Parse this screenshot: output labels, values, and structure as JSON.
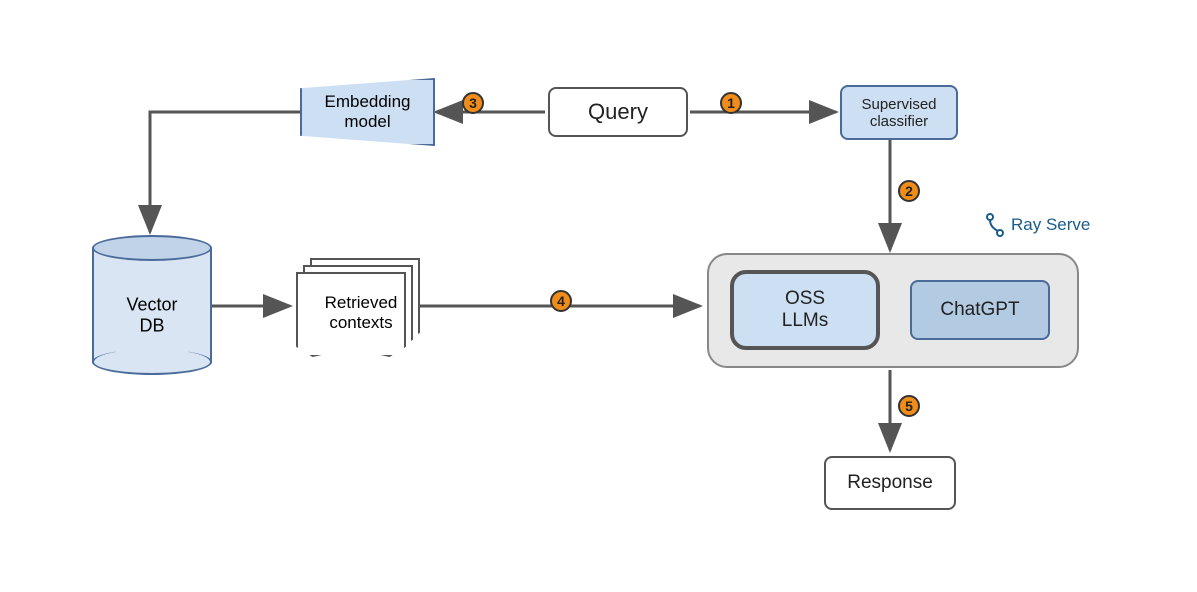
{
  "nodes": {
    "query": "Query",
    "classifier": "Supervised\nclassifier",
    "embedding": "Embedding\nmodel",
    "vector_db": "Vector\nDB",
    "retrieved": "Retrieved\ncontexts",
    "oss_llms": "OSS\nLLMs",
    "chatgpt": "ChatGPT",
    "response": "Response"
  },
  "badges": {
    "b1": "1",
    "b2": "2",
    "b3": "3",
    "b4": "4",
    "b5": "5"
  },
  "labels": {
    "rayserve": "Ray Serve"
  }
}
